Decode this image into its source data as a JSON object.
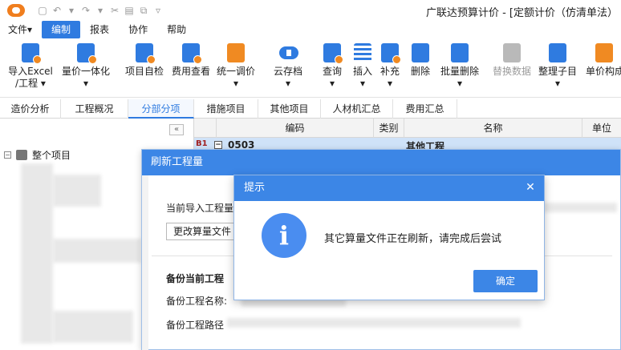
{
  "window": {
    "title": "广联达预算计价 - [定额计价（仿清单法）",
    "quick_access": [
      "▢",
      "↶",
      "▾",
      "↷",
      "▾",
      "✂",
      "▤",
      "⧉",
      "▿"
    ]
  },
  "menu": {
    "items": [
      "文件▾",
      "编制",
      "报表",
      "协作",
      "帮助"
    ],
    "active_index": 1
  },
  "ribbon": {
    "buttons": [
      {
        "label": "导入Excel\n/工程 ▾",
        "icon": "excel-import-icon",
        "color": "#2f7be0"
      },
      {
        "label": "量价一体化\n▾",
        "icon": "quantity-price-icon",
        "color": "#2f7be0"
      },
      {
        "label": "项目自检",
        "icon": "self-check-icon",
        "color": "#2f7be0"
      },
      {
        "label": "费用查看",
        "icon": "fee-view-icon",
        "color": "#2f7be0"
      },
      {
        "label": "统一调价\n▾",
        "icon": "unified-price-icon",
        "color": "#f08a22"
      },
      {
        "label": "云存档\n▾",
        "icon": "cloud-archive-icon",
        "color": "#2f7be0"
      },
      {
        "label": "查询\n▾",
        "icon": "query-icon",
        "color": "#2f7be0"
      },
      {
        "label": "插入\n▾",
        "icon": "insert-icon",
        "color": "#2f7be0"
      },
      {
        "label": "补充\n▾",
        "icon": "supplement-icon",
        "color": "#2f7be0"
      },
      {
        "label": "删除",
        "icon": "delete-icon",
        "color": "#2f7be0"
      },
      {
        "label": "批量删除\n▾",
        "icon": "batch-delete-icon",
        "color": "#2f7be0"
      },
      {
        "label": "替换数据",
        "icon": "replace-data-icon",
        "color": "#b9b9b9"
      },
      {
        "label": "整理子目\n▾",
        "icon": "organize-subitem-icon",
        "color": "#2f7be0"
      },
      {
        "label": "单价构成",
        "icon": "unit-price-icon",
        "color": "#2f7be0"
      }
    ]
  },
  "tabs": {
    "items": [
      "造价分析",
      "工程概况",
      "分部分项",
      "措施项目",
      "其他项目",
      "人材机汇总",
      "费用汇总"
    ],
    "active_index": 2
  },
  "tree": {
    "collapse_label": "«",
    "toggle": "−",
    "root_label": "整个项目"
  },
  "grid": {
    "headers": [
      "编码",
      "类别",
      "名称",
      "单位"
    ],
    "row": {
      "marker": "B1",
      "toggle": "−",
      "code": "0503",
      "name": "其他工程"
    }
  },
  "refresh_dialog": {
    "title": "刷新工程量",
    "current_label": "当前导入工程量",
    "change_button": "更改算量文件",
    "backup_section": "备份当前工程",
    "backup_name_label": "备份工程名称:",
    "backup_path_label": "备份工程路径"
  },
  "prompt_dialog": {
    "title": "提示",
    "close": "✕",
    "icon_glyph": "i",
    "message": "其它算量文件正在刷新，请完成后尝试",
    "ok_button": "确定"
  }
}
